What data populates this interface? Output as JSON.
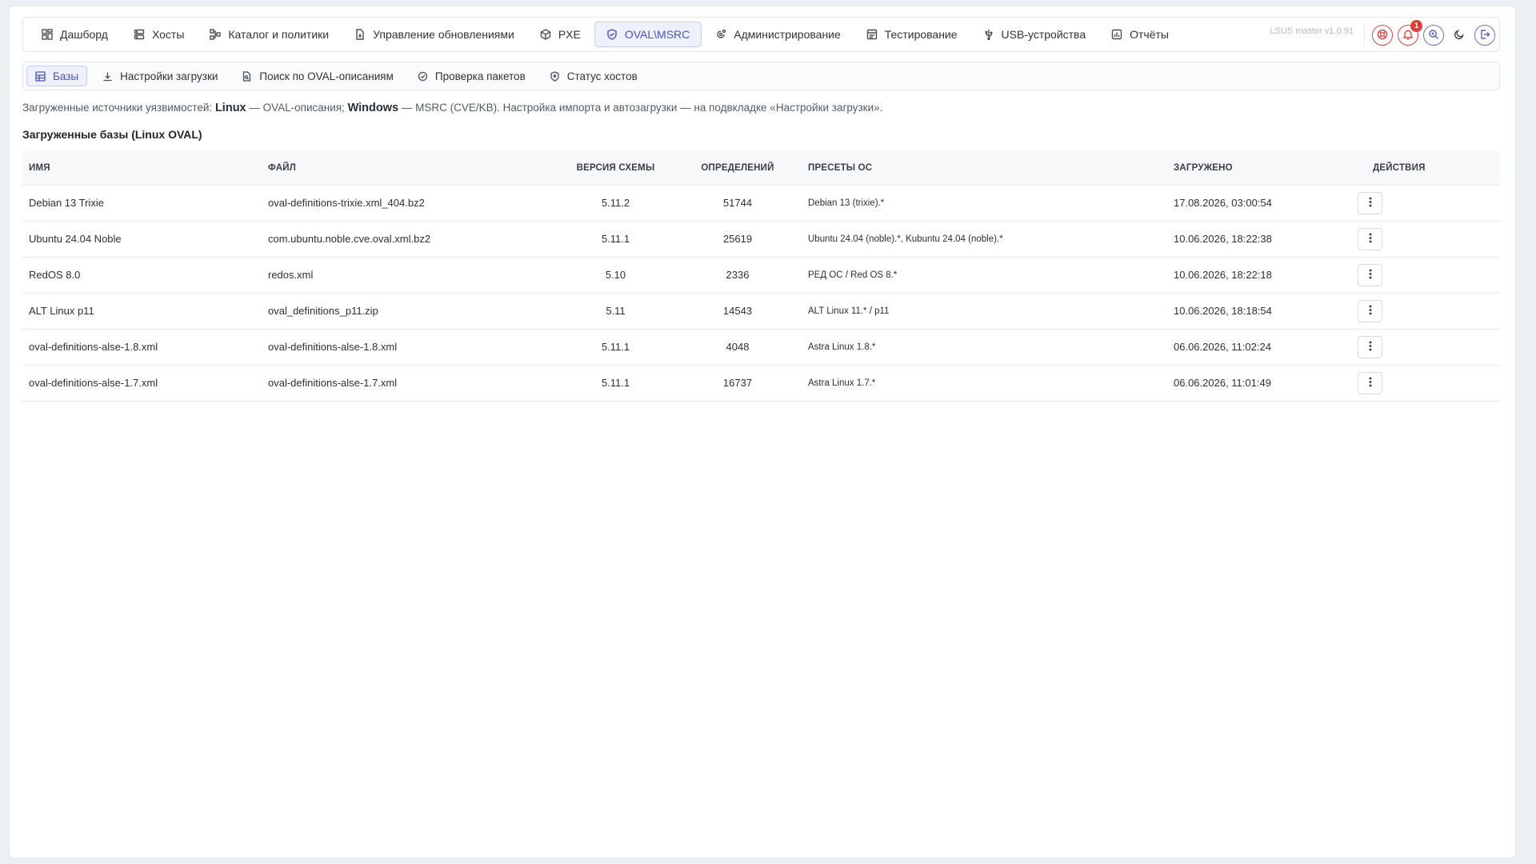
{
  "nav": {
    "items": [
      {
        "label": "Дашборд",
        "icon": "dashboard-icon"
      },
      {
        "label": "Хосты",
        "icon": "server-icon"
      },
      {
        "label": "Каталог и политики",
        "icon": "sitemap-icon"
      },
      {
        "label": "Управление обновлениями",
        "icon": "file-update-icon"
      },
      {
        "label": "PXE",
        "icon": "box-icon"
      },
      {
        "label": "OVAL\\MSRC",
        "icon": "shield-check-icon",
        "active": true
      },
      {
        "label": "Администрирование",
        "icon": "settings-cog-icon"
      },
      {
        "label": "Тестирование",
        "icon": "test-icon"
      },
      {
        "label": "USB-устройства",
        "icon": "usb-icon"
      },
      {
        "label": "Отчёты",
        "icon": "report-icon"
      }
    ],
    "version": "LSUS master v1.0.91",
    "notifications_count": "1"
  },
  "subnav": {
    "items": [
      {
        "label": "Базы",
        "icon": "table-icon",
        "active": true
      },
      {
        "label": "Настройки загрузки",
        "icon": "download-icon"
      },
      {
        "label": "Поиск по OVAL-описаниям",
        "icon": "file-search-icon"
      },
      {
        "label": "Проверка пакетов",
        "icon": "check-circle-icon"
      },
      {
        "label": "Статус хостов",
        "icon": "shield-icon"
      }
    ]
  },
  "info": {
    "prefix": "Загруженные источники уязвимостей: ",
    "linux": "Linux",
    "linux_desc": " — OVAL-описания; ",
    "windows": "Windows",
    "windows_desc": " — MSRC (CVE/KB). Настройка импорта и автозагрузки — на подвкладке «Настройки загрузки»."
  },
  "section_title": "Загруженные базы (Linux OVAL)",
  "table": {
    "headers": {
      "name": "Имя",
      "file": "Файл",
      "schema": "Версия схемы",
      "definitions": "Определений",
      "presets": "Пресеты ОС",
      "loaded": "Загружено",
      "actions": "Действия"
    },
    "rows": [
      {
        "name": "Debian 13 Trixie",
        "file": "oval-definitions-trixie.xml_404.bz2",
        "schema": "5.11.2",
        "definitions": "51744",
        "presets": "Debian 13 (trixie).*",
        "loaded": "17.08.2026, 03:00:54"
      },
      {
        "name": "Ubuntu 24.04 Noble",
        "file": "com.ubuntu.noble.cve.oval.xml.bz2",
        "schema": "5.11.1",
        "definitions": "25619",
        "presets": "Ubuntu 24.04 (noble).*, Kubuntu 24.04 (noble).*",
        "loaded": "10.06.2026, 18:22:38"
      },
      {
        "name": "RedOS 8.0",
        "file": "redos.xml",
        "schema": "5.10",
        "definitions": "2336",
        "presets": "РЕД ОС / Red OS 8.*",
        "loaded": "10.06.2026, 18:22:18"
      },
      {
        "name": "ALT Linux p11",
        "file": "oval_definitions_p11.zip",
        "schema": "5.11",
        "definitions": "14543",
        "presets": "ALT Linux 11.* / p11",
        "loaded": "10.06.2026, 18:18:54"
      },
      {
        "name": "oval-definitions-alse-1.8.xml",
        "file": "oval-definitions-alse-1.8.xml",
        "schema": "5.11.1",
        "definitions": "4048",
        "presets": "Astra Linux 1.8.*",
        "loaded": "06.06.2026, 11:02:24"
      },
      {
        "name": "oval-definitions-alse-1.7.xml",
        "file": "oval-definitions-alse-1.7.xml",
        "schema": "5.11.1",
        "definitions": "16737",
        "presets": "Astra Linux 1.7.*",
        "loaded": "06.06.2026, 11:01:49"
      }
    ]
  },
  "colors": {
    "accent": "#4753c8",
    "danger": "#e53935"
  }
}
